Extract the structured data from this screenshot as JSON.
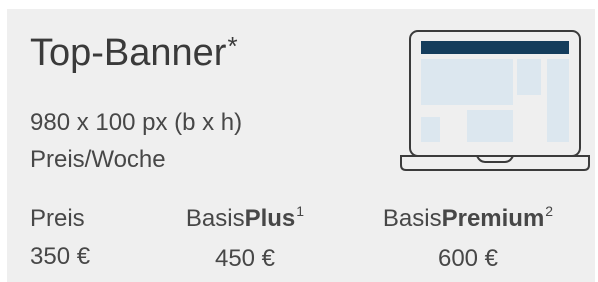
{
  "ad": {
    "title": "Top-Banner",
    "title_marker": "*",
    "dimensions": "980 x 100 px (b x h)",
    "price_period": "Preis/Woche"
  },
  "pricing": {
    "base": {
      "label": "Preis",
      "value": "350 €"
    },
    "plus": {
      "label_prefix": "Basis",
      "label_bold": "Plus",
      "footnote": "1",
      "value": "450 €"
    },
    "premium": {
      "label_prefix": "Basis",
      "label_bold": "Premium",
      "footnote": "2",
      "value": "600 €"
    }
  },
  "icons": {
    "laptop": "laptop-banner-placement-icon"
  },
  "colors": {
    "card_background": "#efefef",
    "text": "#474747",
    "banner": "#153d5c",
    "screen_blocks": "#dce7ef",
    "device_outline": "#3b3b3b"
  }
}
